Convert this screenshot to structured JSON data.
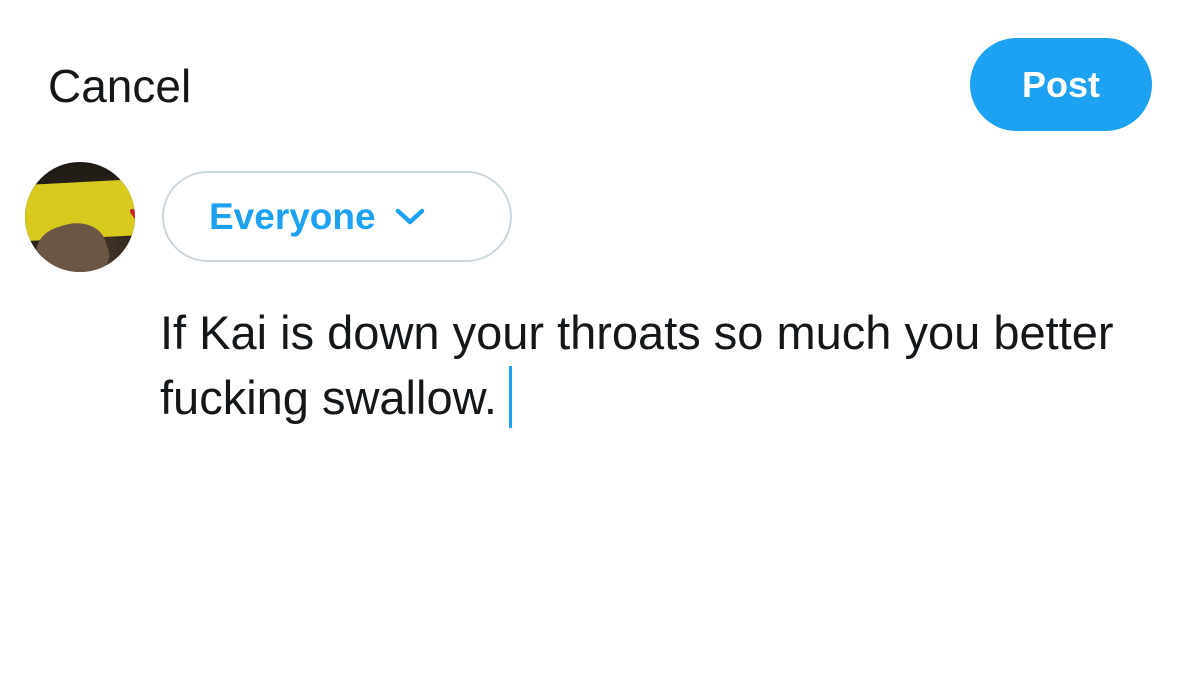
{
  "header": {
    "cancel_label": "Cancel",
    "post_label": "Post"
  },
  "audience": {
    "label": "Everyone"
  },
  "composer": {
    "text": "If Kai is down your throats so much you better fucking swallow."
  },
  "colors": {
    "accent": "#1da1f2",
    "text": "#14171a",
    "pill_border": "#ccd6dd"
  },
  "icons": {
    "audience_dropdown": "chevron-down-icon"
  }
}
